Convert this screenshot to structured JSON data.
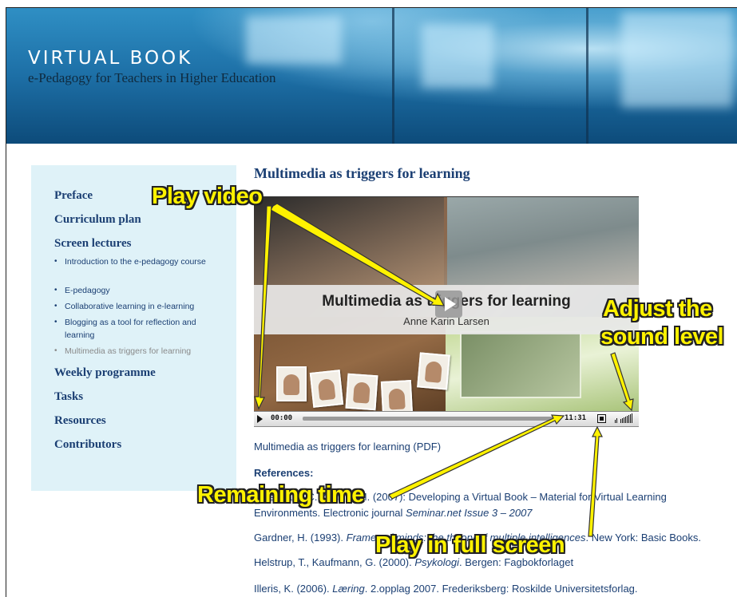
{
  "banner": {
    "title": "VIRTUAL BOOK",
    "subtitle": "e-Pedagogy for Teachers in Higher Education"
  },
  "sidebar": {
    "items": [
      {
        "label": "Preface"
      },
      {
        "label": "Curriculum plan"
      },
      {
        "label": "Screen lectures"
      },
      {
        "label": "Weekly programme"
      },
      {
        "label": "Tasks"
      },
      {
        "label": "Resources"
      },
      {
        "label": "Contributors"
      }
    ],
    "sub_items": [
      {
        "label": "Introduction to the e-pedagogy course"
      },
      {
        "label": "E-pedagogy"
      },
      {
        "label": "Collaborative learning in e-learning"
      },
      {
        "label": "Blogging as a tool for reflection and learning"
      },
      {
        "label": "Multimedia as triggers for learning",
        "current": true
      }
    ]
  },
  "main": {
    "title": "Multimedia as triggers for learning",
    "video": {
      "title": "Multimedia as triggers for learning",
      "author": "Anne Karin Larsen",
      "elapsed": "00:00",
      "remaining": "11:31"
    },
    "pdf_link": "Multimedia as triggers for learning (PDF)",
    "references_heading": "References:",
    "references": [
      {
        "line1_start": "Dalsgaard, C. & Ulvik, M. (2007): Developing a Virtual Book – Material for Virtual Learning",
        "line2_start": "Environments. Electronic journal ",
        "line2_italic": "Seminar.net Issue 3 – 2007"
      },
      {
        "start": "Gardner, H. (1993). ",
        "italic": "Frames of minds: the theory of multiple intelligences",
        "end": ". New York: Basic Books."
      },
      {
        "start": "Helstrup, T., Kaufmann, G. (2000). ",
        "italic": "Psykologi",
        "end": ". Bergen: Fagbokforlaget"
      },
      {
        "start": "Illeris, K. (2006). ",
        "italic": "Læring",
        "end": ". 2.opplag 2007. Frederiksberg: Roskilde Universitetsforlag."
      }
    ]
  },
  "annotations": {
    "play_video": "Play video",
    "adjust_sound_line1": "Adjust the",
    "adjust_sound_line2": "sound level",
    "remaining_time": "Remaining time",
    "full_screen": "Play in full screen",
    "color": "#fff200"
  },
  "colors": {
    "link": "#1b3f73",
    "sidebar_bg": "#dff2f8",
    "banner": "#1d6fa6"
  }
}
